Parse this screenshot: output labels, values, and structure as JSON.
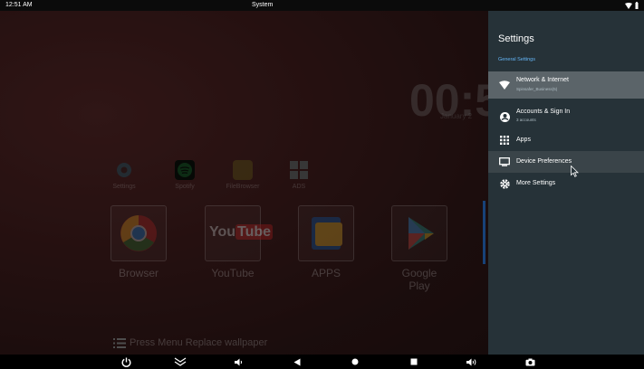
{
  "status_bar": {
    "time": "12:51 AM",
    "title": "System"
  },
  "launcher": {
    "clock": "00:5",
    "date": "January 2",
    "small_apps": [
      {
        "label": "Settings"
      },
      {
        "label": "Spotify"
      },
      {
        "label": "FileBrowser"
      },
      {
        "label": "ADS"
      }
    ],
    "big_apps": [
      {
        "label": "Browser"
      },
      {
        "label": "YouTube",
        "logo_you": "You",
        "logo_tube": "Tube"
      },
      {
        "label": "APPS"
      },
      {
        "label": "Google Play"
      }
    ],
    "hint": "Press Menu Replace wallpaper"
  },
  "settings_panel": {
    "title": "Settings",
    "section": "General Settings",
    "items": [
      {
        "label": "Network & Internet",
        "sub": "Spinsafer_Business(5)",
        "icon": "wifi-icon"
      },
      {
        "label": "Accounts & Sign In",
        "sub": "3 accounts",
        "icon": "account-icon"
      },
      {
        "label": "Apps",
        "sub": "",
        "icon": "apps-grid-icon"
      },
      {
        "label": "Device Preferences",
        "sub": "",
        "icon": "monitor-icon"
      },
      {
        "label": "More Settings",
        "sub": "",
        "icon": "gear-icon"
      }
    ]
  },
  "colors": {
    "panel_bg": "#263238",
    "highlight": "#5b6469",
    "section_accent": "#64b5f6"
  }
}
